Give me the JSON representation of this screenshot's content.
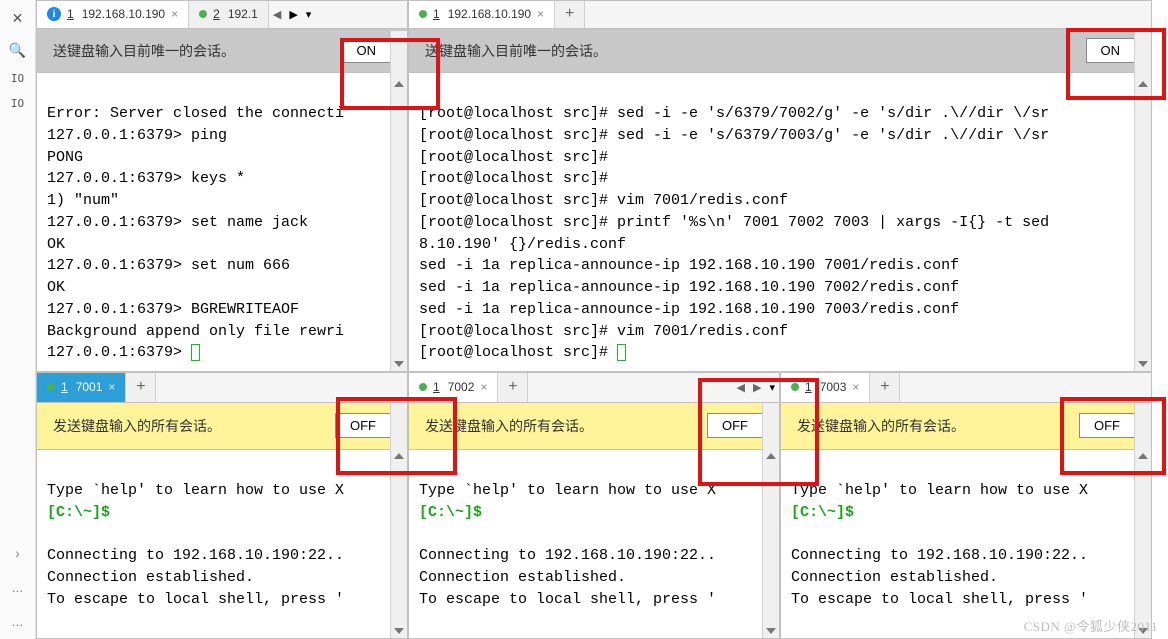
{
  "left_rail": {
    "close": "✕",
    "search": "🔍",
    "io1": "IO",
    "io2": "IO",
    "chev": "›",
    "dots": "..."
  },
  "top_left": {
    "tabs": {
      "t1_num": "1",
      "t1_label": "192.168.10.190",
      "t2_num": "2",
      "t2_label": "192.1",
      "nav_left": "◀",
      "nav_right": "▶",
      "nav_drop": "▾"
    },
    "banner_text": "送键盘输入目前唯一的会话。",
    "toggle": "ON",
    "term_l1": "Error: Server closed the connecti",
    "term_l2": "127.0.0.1:6379> ping",
    "term_l3": "PONG",
    "term_l4": "127.0.0.1:6379> keys *",
    "term_l5": "1) \"num\"",
    "term_l6": "127.0.0.1:6379> set name jack",
    "term_l7": "OK",
    "term_l8": "127.0.0.1:6379> set num 666",
    "term_l9": "OK",
    "term_l10": "127.0.0.1:6379> BGREWRITEAOF",
    "term_l11": "Background append only file rewri",
    "term_l12": "127.0.0.1:6379> "
  },
  "top_right": {
    "tabs": {
      "t1_num": "1",
      "t1_label": "192.168.10.190",
      "plus": "+"
    },
    "banner_text": "送键盘输入目前唯一的会话。",
    "toggle": "ON",
    "term_l1": "[root@localhost src]# sed -i -e 's/6379/7002/g' -e 's/dir .\\//dir \\/sr",
    "term_l2": "[root@localhost src]# sed -i -e 's/6379/7003/g' -e 's/dir .\\//dir \\/sr",
    "term_l3": "[root@localhost src]#",
    "term_l4": "[root@localhost src]#",
    "term_l5": "[root@localhost src]# vim 7001/redis.conf",
    "term_l6": "[root@localhost src]# printf '%s\\n' 7001 7002 7003 | xargs -I{} -t sed",
    "term_l7": "8.10.190' {}/redis.conf",
    "term_l8": "sed -i 1a replica-announce-ip 192.168.10.190 7001/redis.conf",
    "term_l9": "sed -i 1a replica-announce-ip 192.168.10.190 7002/redis.conf",
    "term_l10": "sed -i 1a replica-announce-ip 192.168.10.190 7003/redis.conf",
    "term_l11": "[root@localhost src]# vim 7001/redis.conf",
    "term_l12": "[root@localhost src]# "
  },
  "bottom_common": {
    "banner_text": "发送键盘输入的所有会话。",
    "toggle": "OFF",
    "term_l1": "Type `help' to learn how to use X",
    "term_prompt": "[C:\\~]$",
    "term_blank": " ",
    "term_l3": "Connecting to 192.168.10.190:22..",
    "term_l4": "Connection established.",
    "term_l5": "To escape to local shell, press '"
  },
  "bottom_left": {
    "tab_num": "1",
    "tab_label": "7001",
    "plus": "+"
  },
  "bottom_mid": {
    "tab_num": "1",
    "tab_label": "7002",
    "plus": "+",
    "nav_l": "◀",
    "nav_r": "▶",
    "nav_d": "▾"
  },
  "bottom_right": {
    "tab_num": "1",
    "tab_label": "7003",
    "plus": "+"
  },
  "watermark": "CSDN @令狐少侠2011"
}
